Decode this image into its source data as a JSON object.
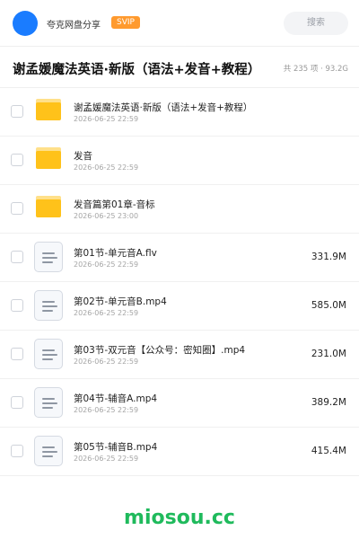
{
  "header": {
    "share_name": "夸克网盘分享",
    "svip_label": "SVIP",
    "search_placeholder": "搜索",
    "colors": {
      "avatar": "#1a7cff",
      "svip": "#ff9a2e"
    }
  },
  "title_bar": {
    "title": "谢孟媛魔法英语·新版（语法+发音+教程）",
    "summary": "共 235 项 · 93.2G"
  },
  "items": [
    {
      "type": "folder",
      "name": "谢孟媛魔法英语·新版（语法+发音+教程）",
      "date": "2026-06-25 22:59",
      "size": ""
    },
    {
      "type": "folder",
      "name": "发音",
      "date": "2026-06-25 22:59",
      "size": ""
    },
    {
      "type": "folder",
      "name": "发音篇第01章-音标",
      "date": "2026-06-25 23:00",
      "size": ""
    },
    {
      "type": "file",
      "name": "第01节-单元音A.flv",
      "date": "2026-06-25 22:59",
      "size": "331.9M"
    },
    {
      "type": "file",
      "name": "第02节-单元音B.mp4",
      "date": "2026-06-25 22:59",
      "size": "585.0M"
    },
    {
      "type": "file",
      "name": "第03节-双元音【公众号：密知圈】.mp4",
      "date": "2026-06-25 22:59",
      "size": "231.0M"
    },
    {
      "type": "file",
      "name": "第04节-辅音A.mp4",
      "date": "2026-06-25 22:59",
      "size": "389.2M"
    },
    {
      "type": "file",
      "name": "第05节-辅音B.mp4",
      "date": "2026-06-25 22:59",
      "size": "415.4M"
    }
  ],
  "watermark": {
    "text": "miosou.cc",
    "color": "#1fba5c"
  }
}
